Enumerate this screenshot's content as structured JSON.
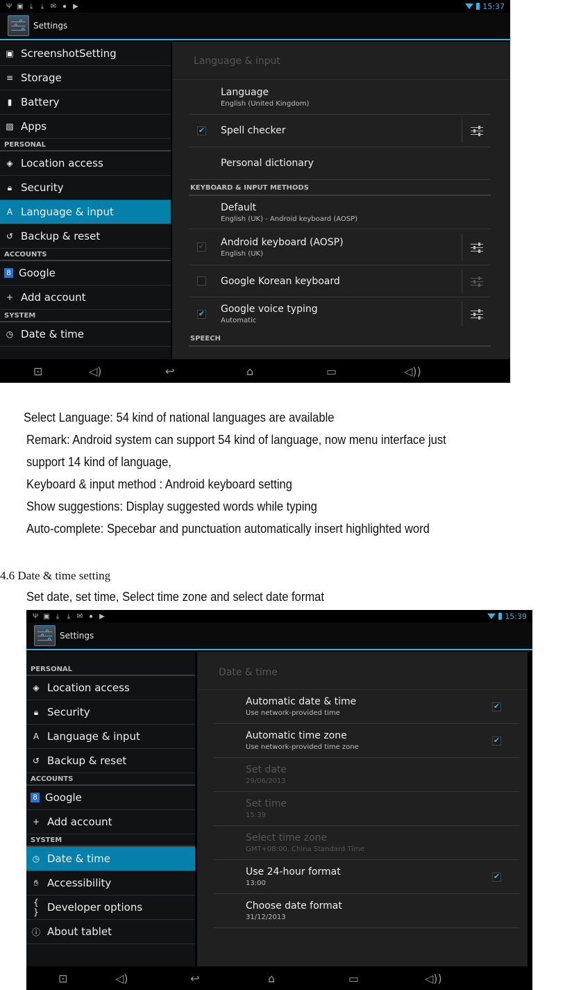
{
  "screenshot1": {
    "status": {
      "time": "15:37"
    },
    "app_title": "Settings",
    "sidebar": [
      {
        "type": "item",
        "icon": "camera-icon",
        "glyph": "▣",
        "label": "ScreenshotSetting"
      },
      {
        "type": "item",
        "icon": "storage-icon",
        "glyph": "≡",
        "label": "Storage"
      },
      {
        "type": "item",
        "icon": "battery-icon",
        "glyph": "▮",
        "label": "Battery"
      },
      {
        "type": "item",
        "icon": "apps-icon",
        "glyph": "▨",
        "label": "Apps"
      },
      {
        "type": "header",
        "label": "PERSONAL"
      },
      {
        "type": "item",
        "icon": "location-icon",
        "glyph": "◈",
        "label": "Location access"
      },
      {
        "type": "item",
        "icon": "lock-icon",
        "glyph": "🔒︎",
        "label": "Security"
      },
      {
        "type": "item",
        "icon": "language-icon",
        "glyph": "A",
        "label": "Language & input",
        "active": true
      },
      {
        "type": "item",
        "icon": "backup-icon",
        "glyph": "↺",
        "label": "Backup & reset"
      },
      {
        "type": "header",
        "label": "ACCOUNTS"
      },
      {
        "type": "item",
        "icon": "google-icon",
        "glyph": "8",
        "label": "Google"
      },
      {
        "type": "item",
        "icon": "plus-icon",
        "glyph": "+",
        "label": "Add account"
      },
      {
        "type": "header",
        "label": "SYSTEM"
      },
      {
        "type": "item",
        "icon": "clock-icon",
        "glyph": "◷",
        "label": "Date & time"
      }
    ],
    "content": {
      "title": "Language & input",
      "language": {
        "title": "Language",
        "summary": "English (United Kingdom)"
      },
      "spell_checker": {
        "title": "Spell checker",
        "checked": true
      },
      "personal_dictionary": {
        "title": "Personal dictionary"
      },
      "category_keyboard": "KEYBOARD & INPUT METHODS",
      "default": {
        "title": "Default",
        "summary": "English (UK) - Android keyboard (AOSP)"
      },
      "android_keyboard": {
        "title": "Android keyboard (AOSP)",
        "summary": "English (UK)",
        "checked": true,
        "disabled_check": true
      },
      "korean_keyboard": {
        "title": "Google Korean keyboard",
        "checked": false
      },
      "voice_typing": {
        "title": "Google voice typing",
        "summary": "Automatic",
        "checked": true
      },
      "category_speech": "SPEECH"
    }
  },
  "doc": {
    "line1": "Select Language: 54 kind of national languages are available",
    "line2": "Remark: Android system can support 54 kind of language, now menu interface just",
    "line3": "support 14 kind of language,",
    "line4": "Keyboard & input method : Android keyboard setting",
    "line5": "Show suggestions: Display suggested words while typing",
    "line6": "Auto-complete: Specebar and punctuation automatically insert highlighted word",
    "section_heading": "4.6 Date & time setting",
    "section_text": "Set date, set time, Select time zone and select date format"
  },
  "screenshot2": {
    "status": {
      "time": "15:39"
    },
    "app_title": "Settings",
    "sidebar": [
      {
        "type": "header",
        "label": "PERSONAL"
      },
      {
        "type": "item",
        "icon": "location-icon",
        "glyph": "◈",
        "label": "Location access"
      },
      {
        "type": "item",
        "icon": "lock-icon",
        "glyph": "🔒︎",
        "label": "Security"
      },
      {
        "type": "item",
        "icon": "language-icon",
        "glyph": "A",
        "label": "Language & input"
      },
      {
        "type": "item",
        "icon": "backup-icon",
        "glyph": "↺",
        "label": "Backup & reset"
      },
      {
        "type": "header",
        "label": "ACCOUNTS"
      },
      {
        "type": "item",
        "icon": "google-icon",
        "glyph": "8",
        "label": "Google"
      },
      {
        "type": "item",
        "icon": "plus-icon",
        "glyph": "+",
        "label": "Add account"
      },
      {
        "type": "header",
        "label": "SYSTEM"
      },
      {
        "type": "item",
        "icon": "clock-icon",
        "glyph": "◷",
        "label": "Date & time",
        "active": true
      },
      {
        "type": "item",
        "icon": "hand-icon",
        "glyph": "✋︎",
        "label": "Accessibility"
      },
      {
        "type": "item",
        "icon": "braces-icon",
        "glyph": "{ }",
        "label": "Developer options"
      },
      {
        "type": "item",
        "icon": "info-icon",
        "glyph": "ⓘ",
        "label": "About tablet"
      }
    ],
    "content": {
      "title": "Date & time",
      "items": [
        {
          "title": "Automatic date & time",
          "summary": "Use network-provided time",
          "checked": true,
          "has_check": true
        },
        {
          "title": "Automatic time zone",
          "summary": "Use network-provided time zone",
          "checked": true,
          "has_check": true
        },
        {
          "title": "Set date",
          "summary": "29/06/2013",
          "disabled": true
        },
        {
          "title": "Set time",
          "summary": "15:39",
          "disabled": true
        },
        {
          "title": "Select time zone",
          "summary": "GMT+08:00, China Standard Time",
          "disabled": true
        },
        {
          "title": "Use 24-hour format",
          "summary": "13:00",
          "checked": true,
          "has_check": true
        },
        {
          "title": "Choose date format",
          "summary": "31/12/2013"
        }
      ]
    }
  },
  "navbar": {
    "buttons": [
      {
        "icon": "screenshot-icon",
        "glyph": "⊡"
      },
      {
        "icon": "volume-down-icon",
        "glyph": "◁)"
      },
      {
        "icon": "back-icon",
        "glyph": "↩"
      },
      {
        "icon": "home-icon",
        "glyph": "⌂"
      },
      {
        "icon": "recent-apps-icon",
        "glyph": "▭"
      },
      {
        "icon": "volume-up-icon",
        "glyph": "◁))"
      }
    ]
  }
}
